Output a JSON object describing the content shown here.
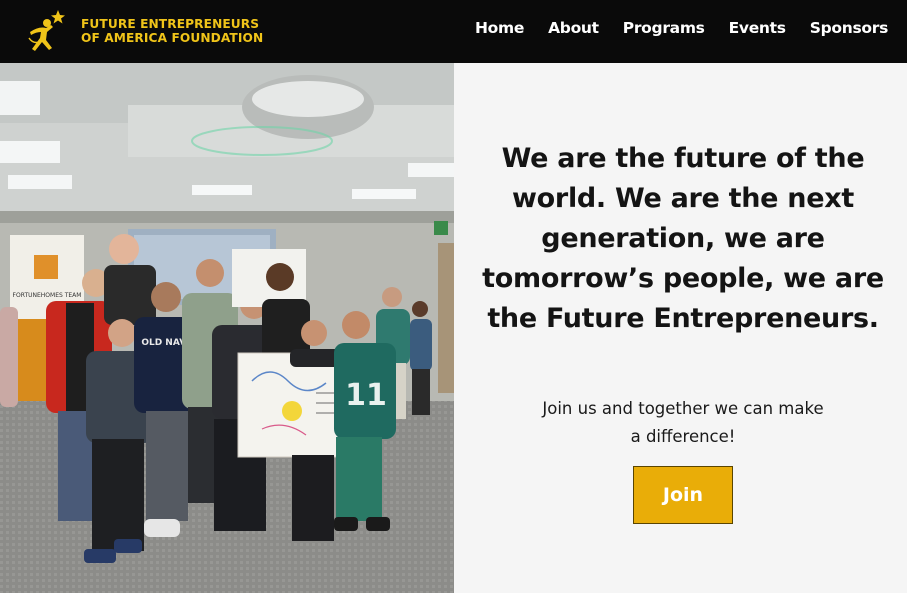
{
  "header": {
    "logo_icon": "running-star-figure-icon",
    "org_name_line1": "FUTURE ENTREPRENEURS",
    "org_name_line2": "OF AMERICA FOUNDATION",
    "nav": [
      {
        "label": "Home"
      },
      {
        "label": "About"
      },
      {
        "label": "Programs"
      },
      {
        "label": "Events"
      },
      {
        "label": "Sponsors"
      }
    ]
  },
  "hero": {
    "photo_banner_text": "FORTUNEHOMES TEAM",
    "photo_shirt_text": "OLD NAVY",
    "photo_jersey_number": "11",
    "headline": "We are the future of the world. We are the next generation, we are tomorrow’s people, we are the Future Entrepreneurs.",
    "subtext": "Join us and together we can make a difference!",
    "button_label": "Join"
  },
  "colors": {
    "navbar_bg": "#0a0a0a",
    "brand_gold": "#f0c419",
    "button_bg": "#e9ad08",
    "content_bg": "#f5f5f5"
  }
}
